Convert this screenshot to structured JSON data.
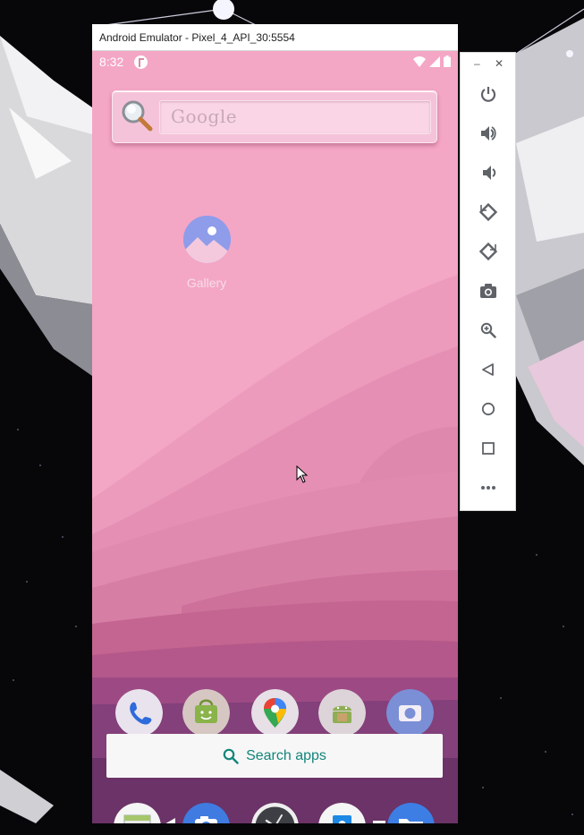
{
  "window": {
    "title": "Android Emulator - Pixel_4_API_30:5554"
  },
  "status_bar": {
    "time": "8:32",
    "icons": [
      "app-notification-icon",
      "wifi-icon",
      "cell-signal-icon",
      "battery-icon"
    ]
  },
  "google_widget": {
    "text": "Google",
    "icon": "magnifier-icon"
  },
  "home": {
    "apps": [
      {
        "label": "Gallery",
        "icon": "gallery-icon"
      }
    ]
  },
  "hotseat": {
    "icons": [
      "phone-icon",
      "app-store-icon",
      "maps-icon",
      "android-app-icon",
      "camera-icon"
    ]
  },
  "search_apps": {
    "label": "Search apps",
    "icon": "search-icon"
  },
  "dock": {
    "icons": [
      "calendar-icon",
      "camera-icon",
      "clock-icon",
      "contacts-icon",
      "files-icon"
    ]
  },
  "side_panel": {
    "window_controls": [
      "minimize",
      "close"
    ],
    "minimize_glyph": "–",
    "close_glyph": "✕",
    "buttons": [
      "power",
      "volume-up",
      "volume-down",
      "rotate-left",
      "rotate-right",
      "screenshot",
      "zoom",
      "back",
      "home",
      "overview",
      "more"
    ]
  },
  "colors": {
    "wallpaper_top": "#f4a7c6",
    "wallpaper_bottom": "#6a2f59",
    "search_accent": "#13857b",
    "side_icon": "#5f6368"
  }
}
